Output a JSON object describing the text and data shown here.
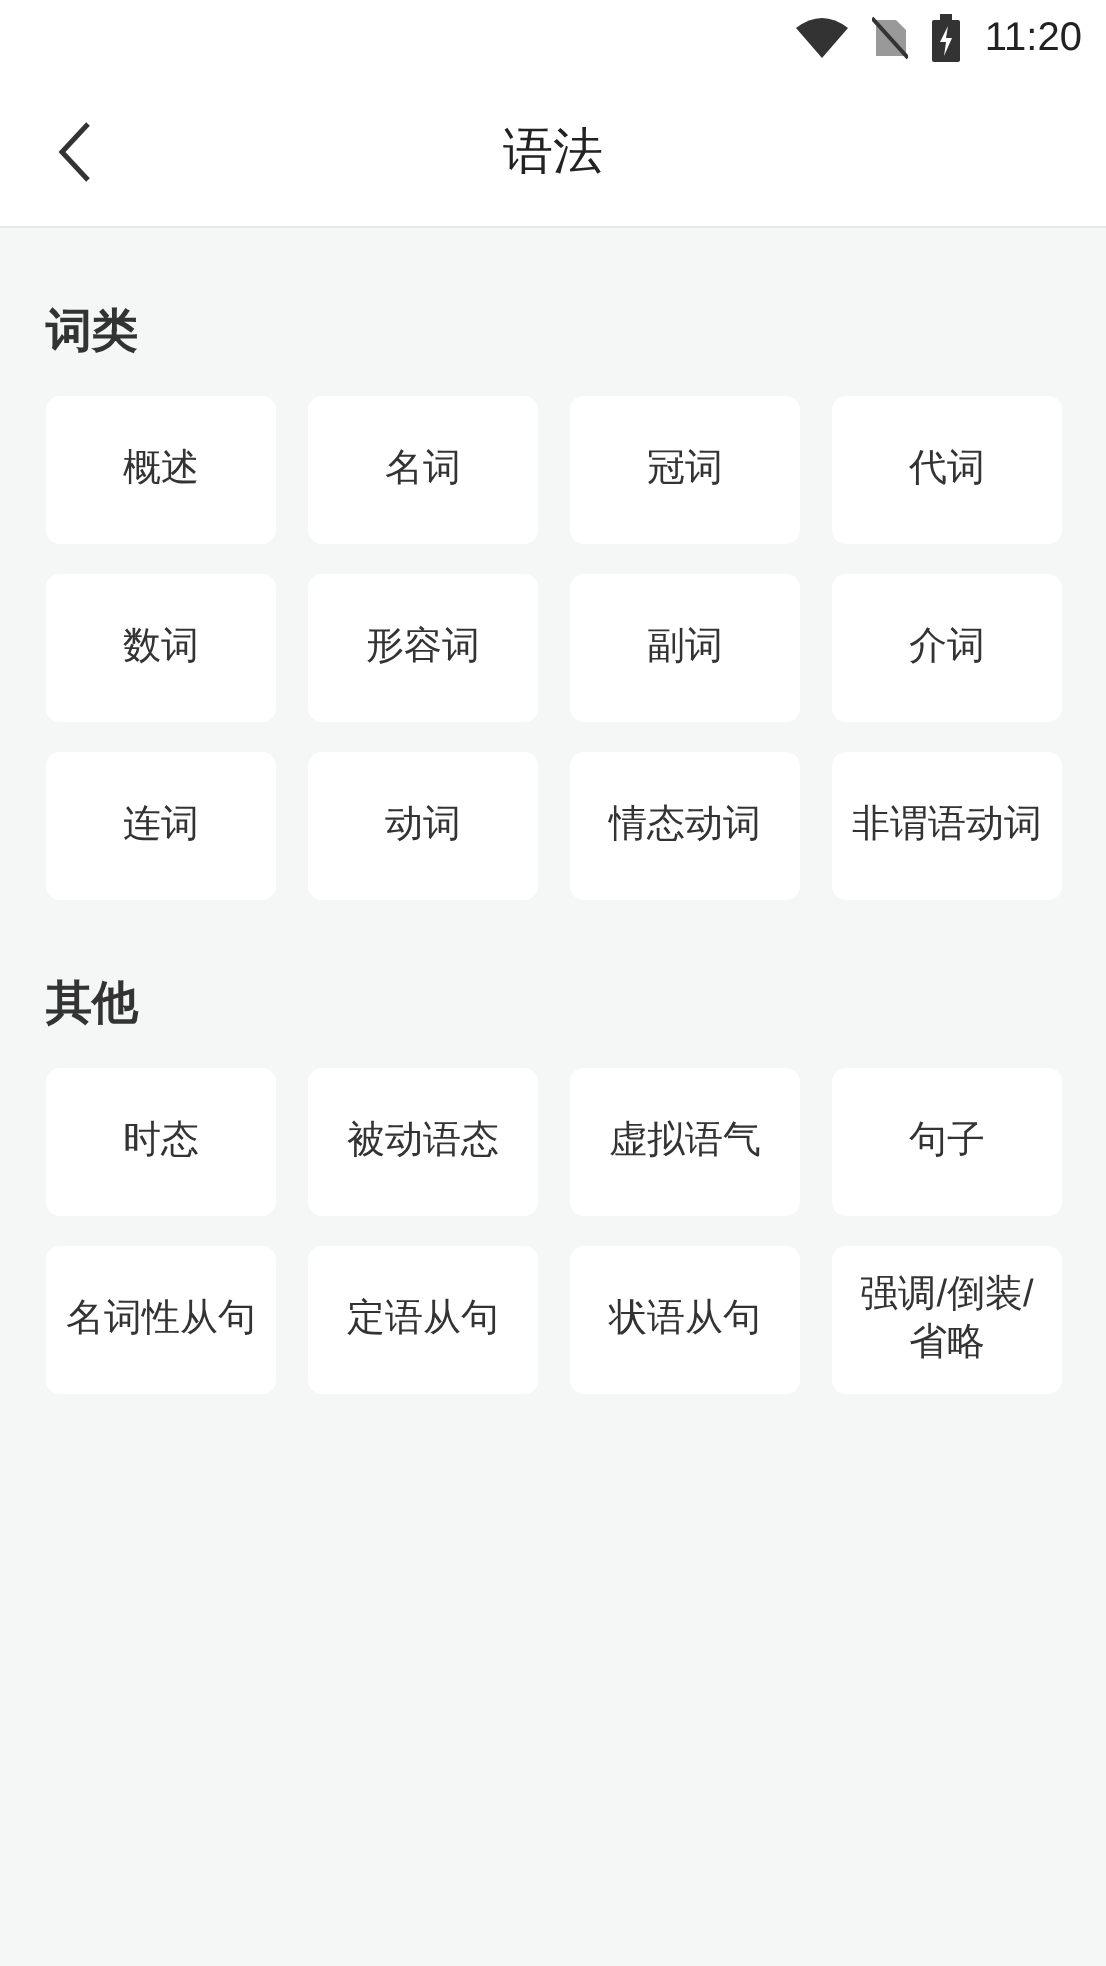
{
  "status_bar": {
    "time": "11:20"
  },
  "header": {
    "title": "语法"
  },
  "sections": [
    {
      "title": "词类",
      "items": [
        "概述",
        "名词",
        "冠词",
        "代词",
        "数词",
        "形容词",
        "副词",
        "介词",
        "连词",
        "动词",
        "情态动词",
        "非谓语动词"
      ]
    },
    {
      "title": "其他",
      "items": [
        "时态",
        "被动语态",
        "虚拟语气",
        "句子",
        "名词性从句",
        "定语从句",
        "状语从句",
        "强调/倒装/省略"
      ]
    }
  ]
}
